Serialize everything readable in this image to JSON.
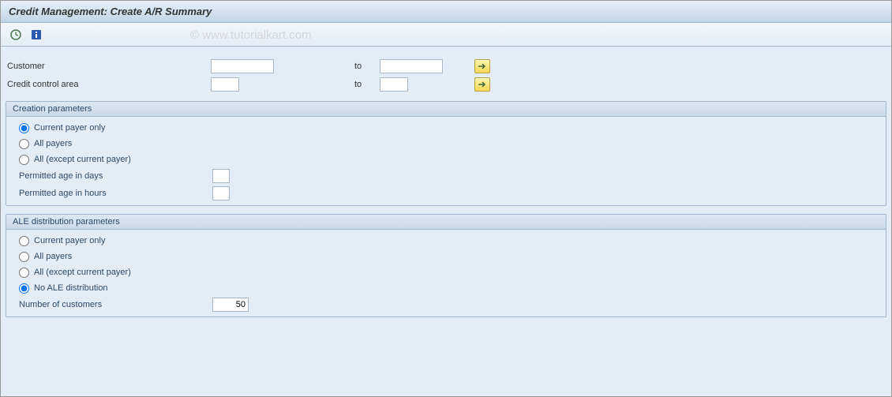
{
  "title": "Credit Management: Create A/R Summary",
  "watermark": "© www.tutorialkart.com",
  "selection": {
    "customer_label": "Customer",
    "customer_from": "",
    "customer_to": "",
    "to_label": "to",
    "cca_label": "Credit control area",
    "cca_from": "",
    "cca_to": ""
  },
  "creation": {
    "title": "Creation parameters",
    "opt1": "Current payer only",
    "opt2": "All payers",
    "opt3": "All (except current payer)",
    "permitted_days_label": "Permitted age in days",
    "permitted_days_value": "",
    "permitted_hours_label": "Permitted age in hours",
    "permitted_hours_value": ""
  },
  "ale": {
    "title": "ALE distribution parameters",
    "opt1": "Current payer only",
    "opt2": "All payers",
    "opt3": "All (except current payer)",
    "opt4": "No ALE distribution",
    "numcust_label": "Number of customers",
    "numcust_value": "50"
  }
}
